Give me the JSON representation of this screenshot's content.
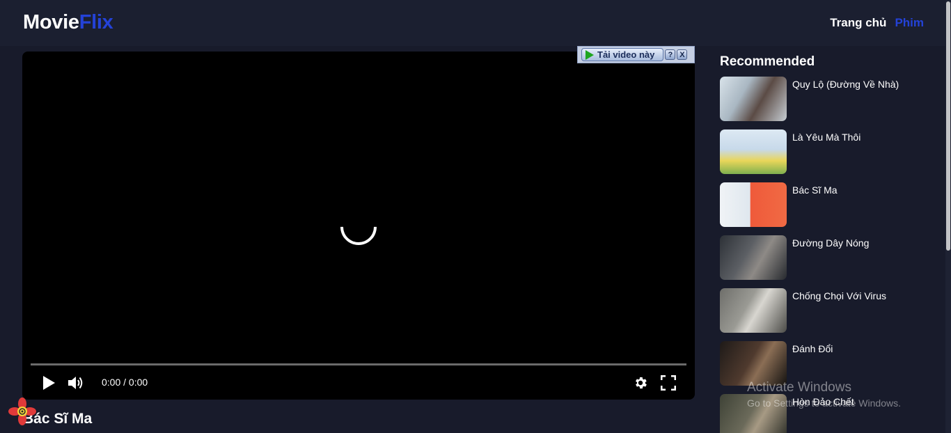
{
  "header": {
    "logo_part1": "Movie",
    "logo_part2": "Flix",
    "nav_home": "Trang chủ",
    "nav_movies": "Phim"
  },
  "download_bar": {
    "label": "Tải video này",
    "help": "?",
    "close": "X"
  },
  "player": {
    "time": "0:00 / 0:00",
    "progress_percent": 0,
    "state": "loading"
  },
  "movie": {
    "title": "Bác Sĩ Ma"
  },
  "recommended": {
    "heading": "Recommended",
    "items": [
      {
        "title": "Quy Lộ (Đường Về Nhà)"
      },
      {
        "title": "Là Yêu Mà Thôi"
      },
      {
        "title": "Bác Sĩ Ma"
      },
      {
        "title": "Đường Dây Nóng"
      },
      {
        "title": "Chống Chọi Với Virus"
      },
      {
        "title": "Đánh Đổi"
      },
      {
        "title": "Hòn Đảo Chết"
      }
    ]
  },
  "watermark": {
    "title": "Activate Windows",
    "subtitle": "Go to Settings to activate Windows."
  },
  "colors": {
    "background": "#181b2b",
    "header": "#1b1f30",
    "accent": "#2442d8"
  }
}
